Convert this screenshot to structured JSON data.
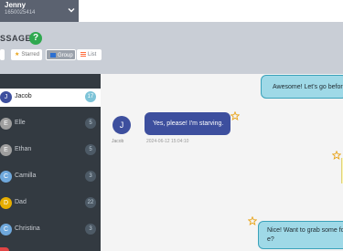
{
  "account": {
    "name": "Jenny",
    "phone": "1650025414"
  },
  "header": {
    "title": "SSAGES",
    "help": "?"
  },
  "filters": {
    "all": "",
    "starred": "Starred",
    "group": "Group",
    "list": "List"
  },
  "contacts": [
    {
      "initial": "J",
      "name": "Jacob",
      "count": "17",
      "color": "#3d4f9e",
      "active": true
    },
    {
      "initial": "E",
      "name": "Elle",
      "count": "5",
      "color": "#9e9e9e"
    },
    {
      "initial": "E",
      "name": "Ethan",
      "count": "5",
      "color": "#9e9e9e"
    },
    {
      "initial": "C",
      "name": "Camilla",
      "count": "3",
      "color": "#6fa8dc"
    },
    {
      "initial": "D",
      "name": "Dad",
      "count": "22",
      "color": "#e6ad00"
    },
    {
      "initial": "C",
      "name": "Christina",
      "count": "3",
      "color": "#6fa8dc"
    }
  ],
  "chat": {
    "messages": [
      {
        "text": "Awesome! Let's go before"
      },
      {
        "text": "Yes, please! I'm starving.",
        "sender": "Jacob",
        "initial": "J",
        "time": "2024-06-12 15:04:10"
      },
      {
        "text": "Nice! Want to grab some foo e?"
      }
    ]
  },
  "colors": {
    "accent": "#3d4f9e",
    "outgoing": "#9fd9e7",
    "sidebar": "#333a41",
    "help": "#2fa84f"
  }
}
